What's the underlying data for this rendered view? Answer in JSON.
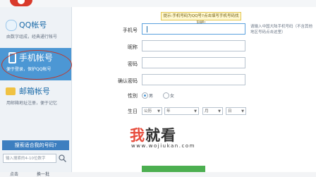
{
  "sidebar": {
    "items": [
      {
        "title": "QQ帐号",
        "subtitle": "由数字组成，经典通行帐号"
      },
      {
        "title": "手机帐号",
        "subtitle": "便于登录，保护QQ帐号"
      },
      {
        "title": "邮箱帐号",
        "subtitle": "用邮箱地址注册，便于记忆"
      }
    ],
    "promo_title": "搜索适合我的号码?",
    "search_placeholder": "输入搜索的4-10位数字",
    "bottom_labels": [
      "点击",
      "换一批"
    ]
  },
  "form": {
    "tip": "提示:手机号码为QQ号?点击填写手机号码找到吧!",
    "labels": {
      "phone": "手机号",
      "nickname": "昵称",
      "password": "密码",
      "confirm": "确认密码",
      "gender": "性别",
      "birthday": "生日"
    },
    "phone_hint": "请输入中国大陆手机号码（不含其他地区号码点击这里）",
    "gender_options": [
      "男",
      "女"
    ],
    "gender_selected": "男",
    "birthday": {
      "calendar": "公历",
      "year": "年",
      "month": "月",
      "day": "日"
    }
  },
  "watermark": {
    "big_1": "我",
    "big_2": "就看",
    "url": "www.wojiukan.com"
  },
  "colors": {
    "accent": "#4c97d4",
    "selected_nav": "#4c97d4",
    "logo": "#d93a2b"
  }
}
